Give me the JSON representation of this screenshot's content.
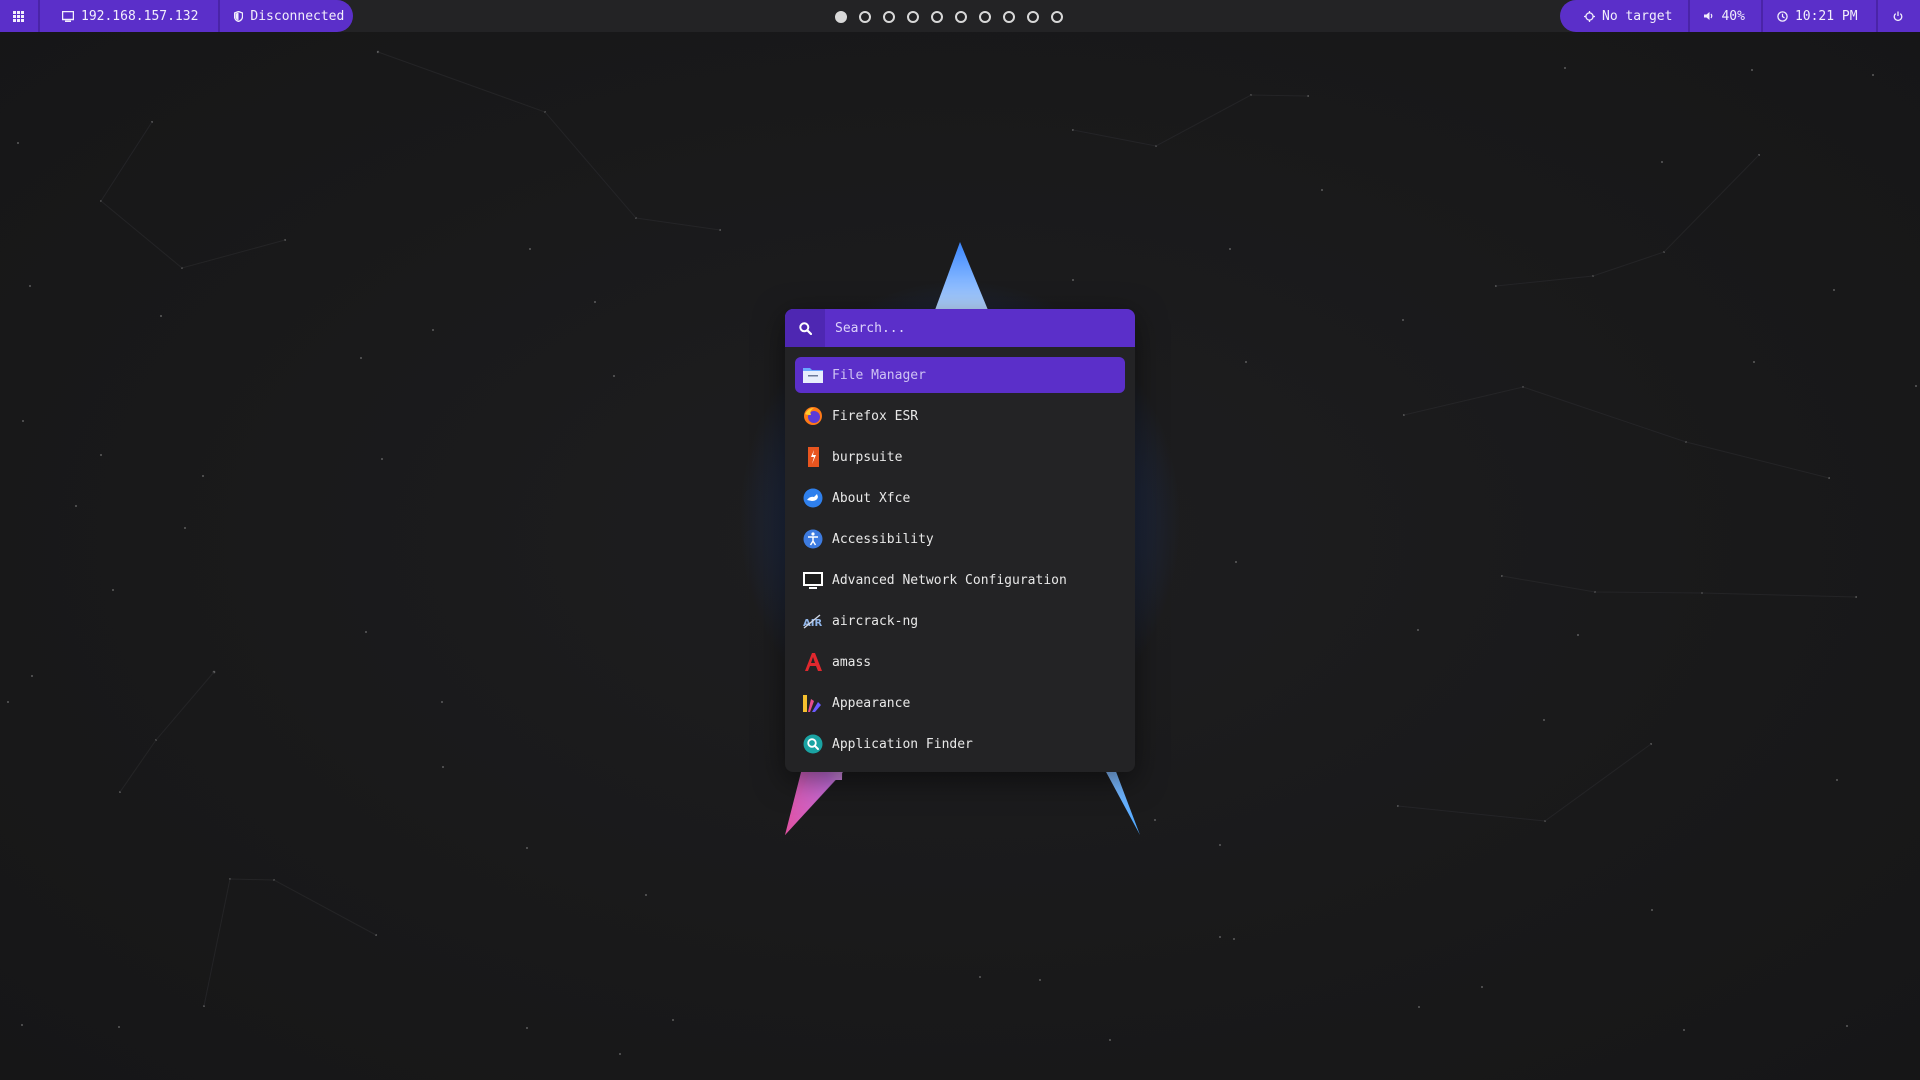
{
  "topbar": {
    "left": {
      "menu_icon": "grid-icon",
      "ip_icon": "monitor-icon",
      "ip_address": "192.168.157.132",
      "vpn_icon": "shield-icon",
      "vpn_status": "Disconnected"
    },
    "workspaces": {
      "count": 10,
      "active_index": 0
    },
    "right": {
      "target_icon": "crosshair-icon",
      "target": "No target",
      "volume_icon": "speaker-icon",
      "volume": "40%",
      "clock_icon": "clock-icon",
      "time": "10:21 PM",
      "power_icon": "power-icon"
    },
    "accent": "#5b2fc9"
  },
  "launcher": {
    "search": {
      "placeholder": "Search...",
      "value": ""
    },
    "apps": [
      {
        "label": "File Manager",
        "icon": "folder-icon",
        "selected": true
      },
      {
        "label": "Firefox ESR",
        "icon": "firefox-icon",
        "selected": false
      },
      {
        "label": "burpsuite",
        "icon": "burpsuite-icon",
        "selected": false
      },
      {
        "label": "About Xfce",
        "icon": "xfce-icon",
        "selected": false
      },
      {
        "label": "Accessibility",
        "icon": "accessibility-icon",
        "selected": false
      },
      {
        "label": "Advanced Network Configuration",
        "icon": "network-icon",
        "selected": false
      },
      {
        "label": "aircrack-ng",
        "icon": "aircrack-icon",
        "selected": false
      },
      {
        "label": "amass",
        "icon": "amass-icon",
        "selected": false
      },
      {
        "label": "Appearance",
        "icon": "appearance-icon",
        "selected": false
      },
      {
        "label": "Application Finder",
        "icon": "app-finder-icon",
        "selected": false
      }
    ]
  }
}
